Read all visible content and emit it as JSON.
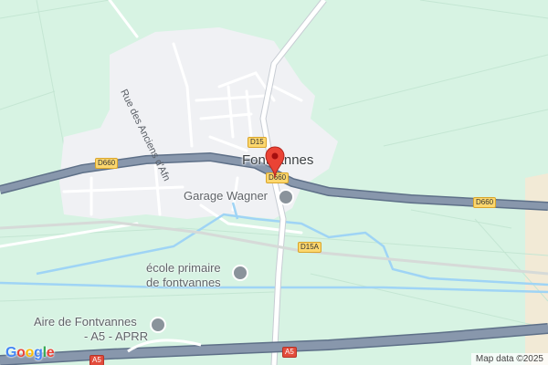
{
  "map": {
    "town_label": "Fontvannes",
    "street_label": "Rue des Anciens d'Afn",
    "roads": {
      "d15": "D15",
      "d660_west": "D660",
      "d660_center": "D660",
      "d660_east": "D660",
      "d15a": "D15A",
      "a5_center": "A5",
      "a5_west": "A5"
    },
    "pois": {
      "garage": "Garage Wagner",
      "school_line1": "école primaire",
      "school_line2": "de fontvannes",
      "rest_line1": "Aire de Fontvannes",
      "rest_line2": "- A5 - APRR"
    },
    "attribution": "Map data ©2025",
    "logo_letters": [
      "G",
      "o",
      "o",
      "g",
      "l",
      "e"
    ],
    "logo_colors": [
      "#4285f4",
      "#ea4335",
      "#fbbc05",
      "#4285f4",
      "#34a853",
      "#ea4335"
    ],
    "colors": {
      "land": "#d7f3e3",
      "urban": "#f0f1f4",
      "water": "#9fd4f5",
      "highway": "#8897ac",
      "pin": "#ea4335"
    }
  }
}
